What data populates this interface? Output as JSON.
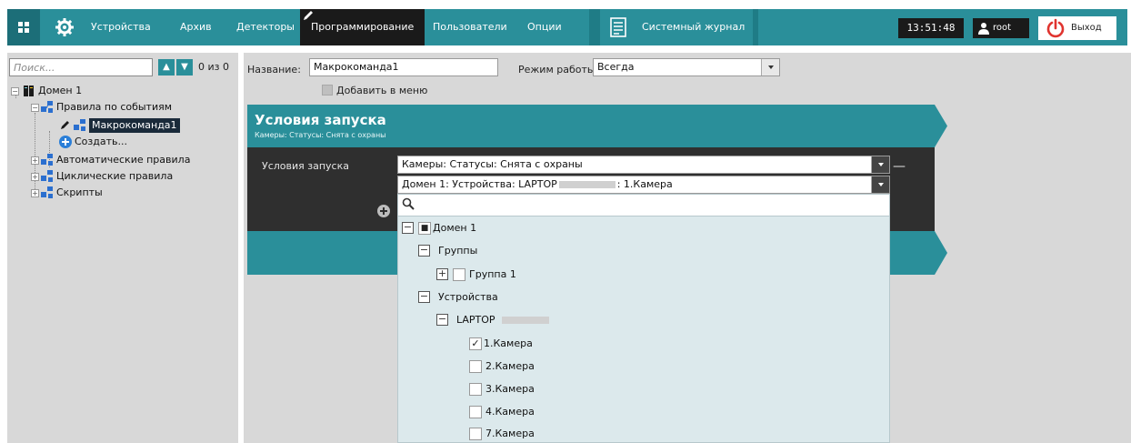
{
  "topbar": {
    "tabs": [
      "Устройства",
      "Архив",
      "Детекторы",
      "Программирование",
      "Пользователи",
      "Опции",
      "Системный журнал"
    ],
    "active_tab": "Программирование",
    "clock": "13:51:48",
    "user": "root",
    "logout_label": "Выход",
    "colors": {
      "bar": "#2a8f9a",
      "active": "#1a1a1a"
    }
  },
  "sidebar": {
    "search_placeholder": "Поиск...",
    "counter": "0 из 0",
    "tree": {
      "root": "Домен 1",
      "event_rules": "Правила по событиям",
      "macro": "Макрокоманда1",
      "create": "Создать...",
      "auto_rules": "Автоматические правила",
      "cyclic_rules": "Циклические правила",
      "scripts": "Скрипты"
    }
  },
  "main": {
    "name_label": "Название:",
    "name_value": "Макрокоманда1",
    "mode_label": "Режим работы",
    "mode_value": "Всегда",
    "add_to_menu_label": "Добавить в меню",
    "conditions_banner": {
      "title": "Условия запуска",
      "subtitle": "Камеры: Статусы: Снята с охраны"
    },
    "conditions_label": "Условия запуска",
    "condition_value": "Камеры: Статусы: Снята с охраны",
    "device_value_prefix": "Домен 1: Устройства: LAPTOP",
    "device_value_suffix": ": 1.Камера",
    "remove_symbol": "—"
  },
  "popup": {
    "root": "Домен 1",
    "groups": "Группы",
    "group1": "Группа 1",
    "devices": "Устройства",
    "laptop": "LAPTOP",
    "cameras": [
      "1.Камера",
      "2.Камера",
      "3.Камера",
      "4.Камера",
      "7.Камера"
    ],
    "checked": [
      "1.Камера"
    ]
  }
}
